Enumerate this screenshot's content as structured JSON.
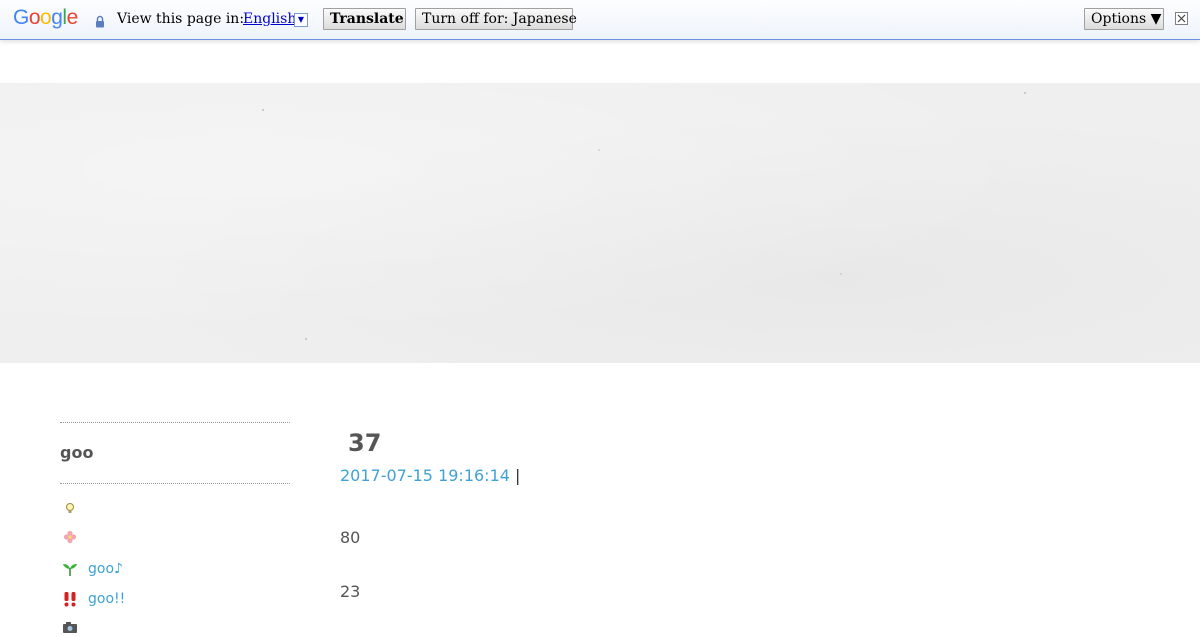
{
  "translate_bar": {
    "logo": [
      "G",
      "o",
      "o",
      "g",
      "l",
      "e"
    ],
    "logo_colors": [
      "#4285f4",
      "#ea4335",
      "#fbbc05",
      "#4285f4",
      "#34a853",
      "#ea4335"
    ],
    "view_text": "View this page in:",
    "language": "English",
    "translate_button": "Translate",
    "turn_off_button": "Turn off for: Japanese",
    "options_button": "Options ▼",
    "lang_dropdown_glyph": "▼"
  },
  "sidebar": {
    "title": "goo",
    "items": [
      {
        "icon": "lightbulb-icon",
        "label": ""
      },
      {
        "icon": "flower-icon",
        "label": ""
      },
      {
        "icon": "sprout-icon",
        "label": "goo♪"
      },
      {
        "icon": "exclamation-icon",
        "label": "goo!!"
      },
      {
        "icon": "camera-icon",
        "label": ""
      }
    ]
  },
  "post": {
    "title": "37",
    "date": "2017-07-15 19:16:14",
    "separator": "|",
    "lines": [
      "80",
      "23"
    ]
  },
  "colors": {
    "link": "#3fa2d4",
    "text": "#555555",
    "banner": "#efefef"
  }
}
